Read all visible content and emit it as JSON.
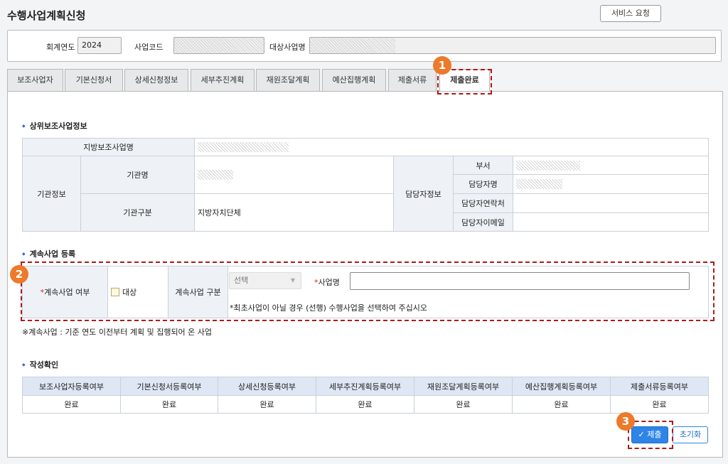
{
  "page": {
    "title": "수행사업계획신청",
    "service_button": "서비스 요청"
  },
  "header": {
    "year_label": "회계연도",
    "year_value": "2024",
    "code_label": "사업코드",
    "target_label": "대상사업명"
  },
  "tabs": [
    "보조사업자",
    "기본신청서",
    "상세신청정보",
    "세부추진계획",
    "재원조달계획",
    "예산집행계획",
    "제출서류",
    "제출완료"
  ],
  "upper": {
    "title": "상위보조사업정보",
    "local_name_label": "지방보조사업명",
    "org_info_label": "기관정보",
    "org_name_label": "기관명",
    "org_type_label": "기관구분",
    "org_type_value": "지방자치단체",
    "manager_info_label": "담당자정보",
    "dept_label": "부서",
    "manager_name_label": "담당자명",
    "contact_label": "담당자연락처",
    "email_label": "담당자이메일"
  },
  "cont": {
    "title": "계속사업 등록",
    "req_mark": "*",
    "flag_label": "계속사업 여부",
    "flag_option": "대상",
    "type_label": "계속사업 구분",
    "select_value": "선택",
    "name_label": "사업명",
    "hint": "*최초사업이 아닐 경우 (선행) 수행사업을 선택하여 주십시오",
    "note": "※계속사업 : 기준 연도 이전부터 계획 및 집행되어 온 사업"
  },
  "confirm": {
    "title": "작성확인",
    "headers": [
      "보조사업자등록여부",
      "기본신청서등록여부",
      "상세신청등록여부",
      "세부추진계획등록여부",
      "재원조달계획등록여부",
      "예산집행계획등록여부",
      "제출서류등록여부"
    ],
    "values": [
      "완료",
      "완료",
      "완료",
      "완료",
      "완료",
      "완료",
      "완료"
    ]
  },
  "actions": {
    "submit": "✓ 제출",
    "reset": "초기화"
  },
  "markers": [
    "1",
    "2",
    "3"
  ],
  "colors": {
    "accent": "#2f84e8",
    "marker": "#ec7a2a",
    "highlight": "#b01818"
  }
}
